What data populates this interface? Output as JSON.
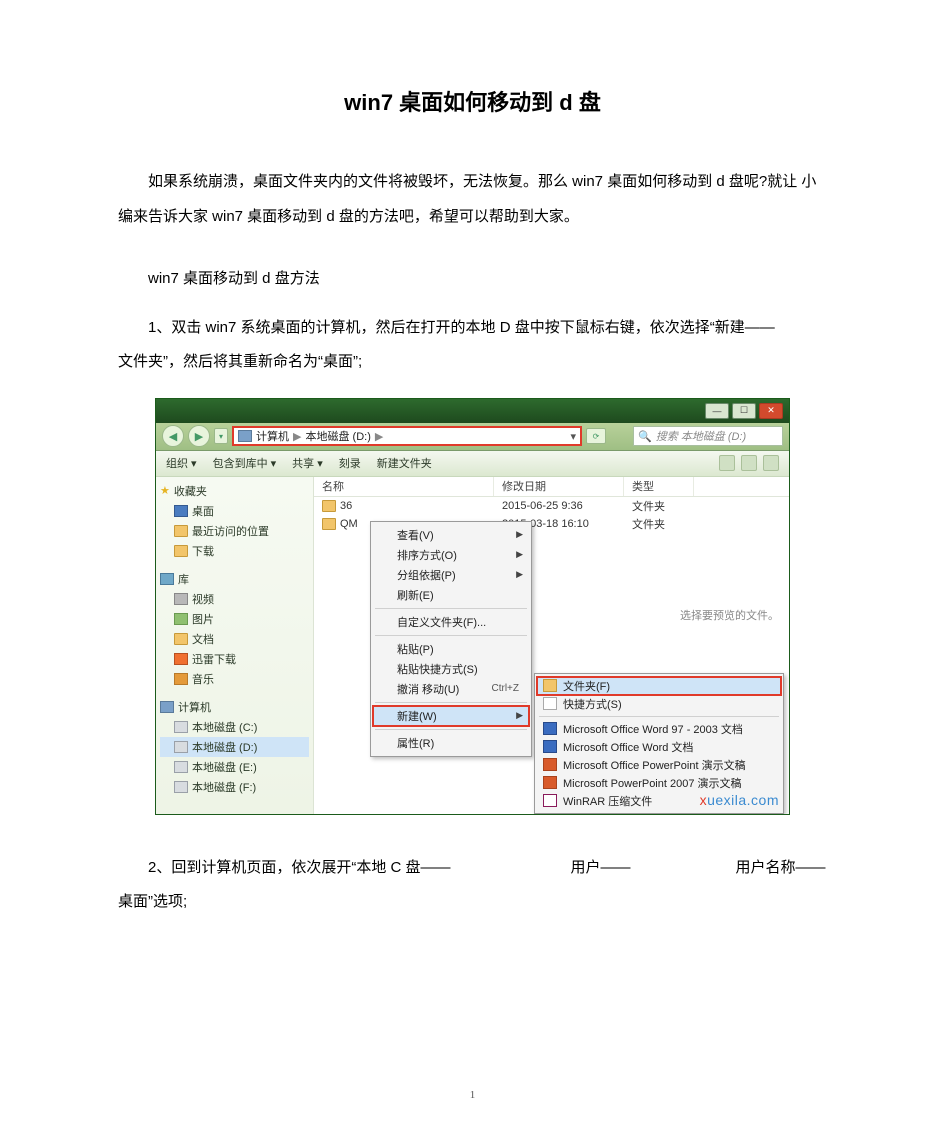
{
  "title": "win7 桌面如何移动到 d 盘",
  "para1": "如果系统崩溃，桌面文件夹内的文件将被毁坏，无法恢复。那么 win7 桌面如何移动到 d 盘呢?就让 小编来告诉大家 win7 桌面移动到 d 盘的方法吧，希望可以帮助到大家。",
  "heading_method": "win7 桌面移动到 d 盘方法",
  "step1": "1、双击 win7 系统桌面的计算机，然后在打开的本地 D 盘中按下鼠标右键，依次选择“新建——　　　　　　　文件夹”，然后将其重新命名为“桌面”;",
  "step2": "2、回到计算机页面，依次展开“本地 C 盘——　　　　　　　　用户——　　　　　　　用户名称——　　　　　　　桌面”选项;",
  "page_number": "1",
  "explorer": {
    "window_controls": {
      "min": "—",
      "max": "☐",
      "close": "✕"
    },
    "nav": {
      "back": "◀",
      "fwd": "▶",
      "drop": "▾",
      "path_seg1": "计算机",
      "path_seg2": "本地磁盘 (D:)",
      "arrow": "▶",
      "refresh": "⟳",
      "search_placeholder": "搜索 本地磁盘 (D:)",
      "search_icon": "🔍"
    },
    "toolbar": {
      "org": "组织 ▾",
      "include": "包含到库中 ▾",
      "share": "共享 ▾",
      "burn": "刻录",
      "newfolder": "新建文件夹"
    },
    "sidebar": {
      "fav_head": "收藏夹",
      "fav": [
        "桌面",
        "最近访问的位置",
        "下载"
      ],
      "lib_head": "库",
      "lib": [
        "视频",
        "图片",
        "文档",
        "迅雷下载",
        "音乐"
      ],
      "pc_head": "计算机",
      "pc": [
        "本地磁盘 (C:)",
        "本地磁盘 (D:)",
        "本地磁盘 (E:)",
        "本地磁盘 (F:)"
      ]
    },
    "columns": {
      "name": "名称",
      "date": "修改日期",
      "type": "类型"
    },
    "rows": [
      {
        "name": "36",
        "date": "2015-06-25 9:36",
        "type": "文件夹"
      },
      {
        "name": "QM",
        "date": "2015-03-18 16:10",
        "type": "文件夹"
      }
    ],
    "ctx": {
      "view": "查看(V)",
      "sort": "排序方式(O)",
      "group": "分组依据(P)",
      "refresh": "刷新(E)",
      "custom": "自定义文件夹(F)...",
      "paste": "粘贴(P)",
      "paste_shortcut": "粘贴快捷方式(S)",
      "undo": "撤消 移动(U)",
      "undo_kb": "Ctrl+Z",
      "new": "新建(W)",
      "prop": "属性(R)"
    },
    "submenu": {
      "folder": "文件夹(F)",
      "shortcut": "快捷方式(S)",
      "word97": "Microsoft Office Word 97 - 2003 文档",
      "word": "Microsoft Office Word 文档",
      "ppt": "Microsoft Office PowerPoint 演示文稿",
      "ppt07": "Microsoft PowerPoint 2007 演示文稿",
      "rar": "WinRAR 压缩文件"
    },
    "preview_hint": "选择要预览的文件。",
    "watermark_x": "x",
    "watermark_rest": "uexila.com"
  }
}
